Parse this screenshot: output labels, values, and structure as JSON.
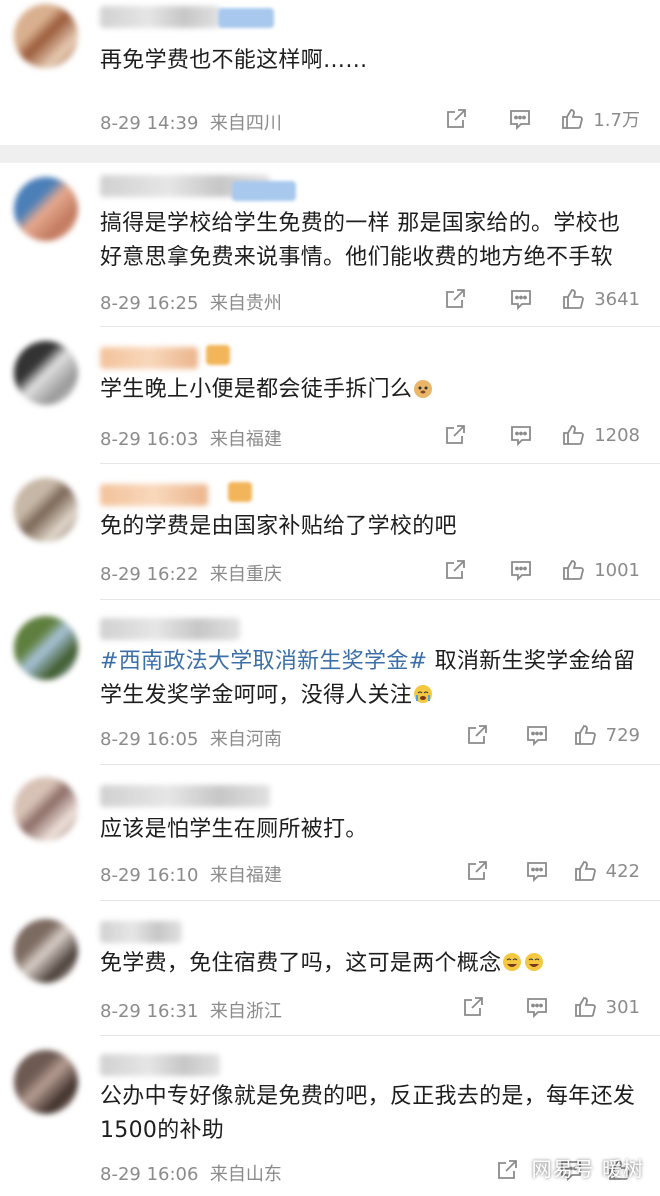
{
  "comments": [
    {
      "text": "再免学费也不能这样啊……",
      "date": "8-29 14:39",
      "location": "来自四川",
      "likes": "1.7万",
      "avatar_colors": [
        "#d9b08f",
        "#9a5a3a",
        "#e8cdb5"
      ]
    },
    {
      "text": "搞得是学校给学生免费的一样 那是国家给的。学校也好意思拿免费来说事情。他们能收费的地方绝不手软",
      "date": "8-29 16:25",
      "location": "来自贵州",
      "likes": "3641",
      "avatar_colors": [
        "#4b7fb8",
        "#e5a98f",
        "#c27a5f"
      ]
    },
    {
      "text": "学生晚上小便是都会徒手拆门么",
      "date": "8-29 16:03",
      "location": "来自福建",
      "likes": "1208",
      "avatar_colors": [
        "#333333",
        "#e0e0e0",
        "#999999"
      ]
    },
    {
      "text": "免的学费是由国家补贴给了学校的吧",
      "date": "8-29 16:22",
      "location": "来自重庆",
      "likes": "1001",
      "avatar_colors": [
        "#c7b7a6",
        "#7a6656",
        "#e2d8cc"
      ]
    },
    {
      "topic": "#西南政法大学取消新生奖学金#",
      "text": " 取消新生奖学金给留学生发奖学金呵呵，没得人关注",
      "date": "8-29 16:05",
      "location": "来自河南",
      "likes": "729",
      "avatar_colors": [
        "#5f7f3f",
        "#a9c4da",
        "#3e5a2a"
      ]
    },
    {
      "text": "应该是怕学生在厕所被打。",
      "date": "8-29 16:10",
      "location": "来自福建",
      "likes": "422",
      "avatar_colors": [
        "#d8c2b6",
        "#8c6d66",
        "#f0e3dc"
      ]
    },
    {
      "text": "免学费，免住宿费了吗，这可是两个概念",
      "date": "8-29 16:31",
      "location": "来自浙江",
      "likes": "301",
      "avatar_colors": [
        "#7c6b61",
        "#d9cfc8",
        "#4a3f39"
      ]
    },
    {
      "text": "公办中专好像就是免费的吧，反正我去的是，每年还发1500的补助",
      "date": "8-29 16:06",
      "location": "来自山东",
      "likes": "",
      "avatar_colors": [
        "#6e5a53",
        "#b69d92",
        "#3f302b"
      ]
    }
  ],
  "watermark": "网易号 暖树",
  "colors": {
    "topic": "#3c6fa8",
    "meta": "#8b8b8b",
    "divider": "#e6e6e6"
  }
}
